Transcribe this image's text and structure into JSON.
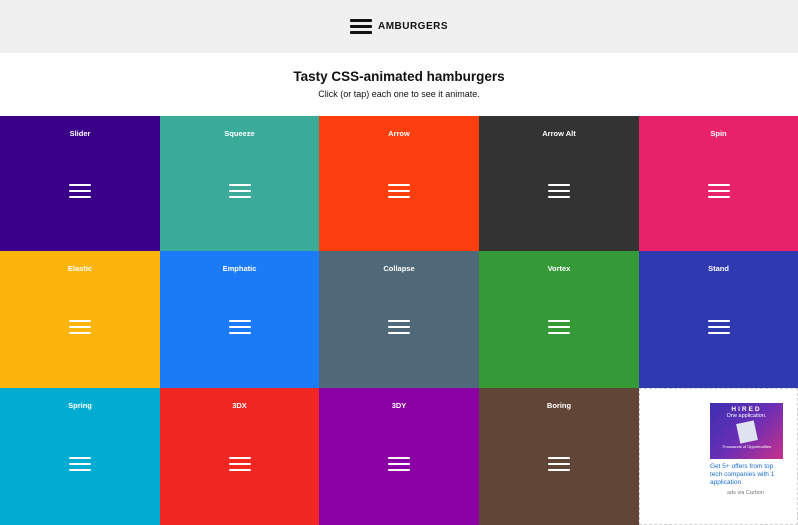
{
  "header": {
    "logo_text": "AMBURGERS"
  },
  "intro": {
    "title": "Tasty CSS-animated hamburgers",
    "subtitle": "Click (or tap) each one to see it animate."
  },
  "tiles": [
    {
      "label": "Slider",
      "color": "#3a0088"
    },
    {
      "label": "Squeeze",
      "color": "#3aab98"
    },
    {
      "label": "Arrow",
      "color": "#fd3f10"
    },
    {
      "label": "Arrow Alt",
      "color": "#333333"
    },
    {
      "label": "Spin",
      "color": "#e8226a"
    },
    {
      "label": "Elastic",
      "color": "#fab40b"
    },
    {
      "label": "Emphatic",
      "color": "#1b7bf6"
    },
    {
      "label": "Collapse",
      "color": "#4f6979"
    },
    {
      "label": "Vortex",
      "color": "#359937"
    },
    {
      "label": "Stand",
      "color": "#2f3ab0"
    },
    {
      "label": "Spring",
      "color": "#00acd1"
    },
    {
      "label": "3DX",
      "color": "#f02622"
    },
    {
      "label": "3DY",
      "color": "#8a00a5"
    },
    {
      "label": "Boring",
      "color": "#614637"
    }
  ],
  "ad": {
    "brand": "HIRED",
    "headline": "One application.",
    "subline": "Thousands of Opportunities",
    "text": "Get 5+ offers from top tech companies with 1 application",
    "via": "ads via Carbon"
  },
  "icons": {
    "logo": "hamburger-menu-icon",
    "tile": "hamburger-menu-icon"
  }
}
